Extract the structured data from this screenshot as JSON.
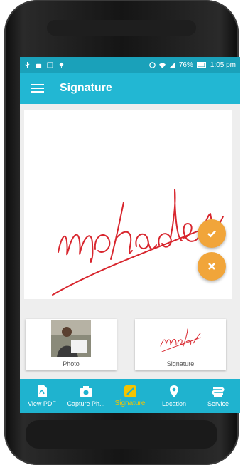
{
  "status_bar": {
    "battery": "76%",
    "time": "1:05 pm"
  },
  "toolbar": {
    "title": "Signature"
  },
  "signature": {
    "text": "mahaden",
    "ink_color": "#d8262e"
  },
  "actions": {
    "accept_icon": "check-icon",
    "clear_icon": "close-icon",
    "color": "#f1a53a"
  },
  "thumbnails": [
    {
      "label": "Photo"
    },
    {
      "label": "Signature"
    }
  ],
  "bottom_nav": [
    {
      "label": "View PDF",
      "icon": "pdf-icon"
    },
    {
      "label": "Capture Ph...",
      "icon": "camera-icon"
    },
    {
      "label": "Signature",
      "icon": "pen-icon",
      "active": true
    },
    {
      "label": "Location",
      "icon": "location-pin-icon"
    },
    {
      "label": "Service",
      "icon": "service-icon"
    }
  ],
  "theme": {
    "primary": "#22b7d3",
    "status": "#1aa1ba",
    "active_nav": "#f4c400"
  }
}
